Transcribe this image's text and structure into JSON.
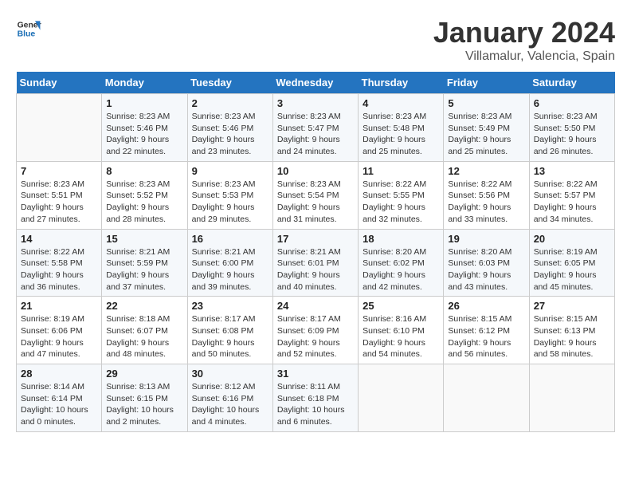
{
  "logo": {
    "line1": "General",
    "line2": "Blue"
  },
  "title": "January 2024",
  "subtitle": "Villamalur, Valencia, Spain",
  "headers": [
    "Sunday",
    "Monday",
    "Tuesday",
    "Wednesday",
    "Thursday",
    "Friday",
    "Saturday"
  ],
  "weeks": [
    [
      {
        "day": "",
        "info": ""
      },
      {
        "day": "1",
        "info": "Sunrise: 8:23 AM\nSunset: 5:46 PM\nDaylight: 9 hours\nand 22 minutes."
      },
      {
        "day": "2",
        "info": "Sunrise: 8:23 AM\nSunset: 5:46 PM\nDaylight: 9 hours\nand 23 minutes."
      },
      {
        "day": "3",
        "info": "Sunrise: 8:23 AM\nSunset: 5:47 PM\nDaylight: 9 hours\nand 24 minutes."
      },
      {
        "day": "4",
        "info": "Sunrise: 8:23 AM\nSunset: 5:48 PM\nDaylight: 9 hours\nand 25 minutes."
      },
      {
        "day": "5",
        "info": "Sunrise: 8:23 AM\nSunset: 5:49 PM\nDaylight: 9 hours\nand 25 minutes."
      },
      {
        "day": "6",
        "info": "Sunrise: 8:23 AM\nSunset: 5:50 PM\nDaylight: 9 hours\nand 26 minutes."
      }
    ],
    [
      {
        "day": "7",
        "info": "Sunrise: 8:23 AM\nSunset: 5:51 PM\nDaylight: 9 hours\nand 27 minutes."
      },
      {
        "day": "8",
        "info": "Sunrise: 8:23 AM\nSunset: 5:52 PM\nDaylight: 9 hours\nand 28 minutes."
      },
      {
        "day": "9",
        "info": "Sunrise: 8:23 AM\nSunset: 5:53 PM\nDaylight: 9 hours\nand 29 minutes."
      },
      {
        "day": "10",
        "info": "Sunrise: 8:23 AM\nSunset: 5:54 PM\nDaylight: 9 hours\nand 31 minutes."
      },
      {
        "day": "11",
        "info": "Sunrise: 8:22 AM\nSunset: 5:55 PM\nDaylight: 9 hours\nand 32 minutes."
      },
      {
        "day": "12",
        "info": "Sunrise: 8:22 AM\nSunset: 5:56 PM\nDaylight: 9 hours\nand 33 minutes."
      },
      {
        "day": "13",
        "info": "Sunrise: 8:22 AM\nSunset: 5:57 PM\nDaylight: 9 hours\nand 34 minutes."
      }
    ],
    [
      {
        "day": "14",
        "info": "Sunrise: 8:22 AM\nSunset: 5:58 PM\nDaylight: 9 hours\nand 36 minutes."
      },
      {
        "day": "15",
        "info": "Sunrise: 8:21 AM\nSunset: 5:59 PM\nDaylight: 9 hours\nand 37 minutes."
      },
      {
        "day": "16",
        "info": "Sunrise: 8:21 AM\nSunset: 6:00 PM\nDaylight: 9 hours\nand 39 minutes."
      },
      {
        "day": "17",
        "info": "Sunrise: 8:21 AM\nSunset: 6:01 PM\nDaylight: 9 hours\nand 40 minutes."
      },
      {
        "day": "18",
        "info": "Sunrise: 8:20 AM\nSunset: 6:02 PM\nDaylight: 9 hours\nand 42 minutes."
      },
      {
        "day": "19",
        "info": "Sunrise: 8:20 AM\nSunset: 6:03 PM\nDaylight: 9 hours\nand 43 minutes."
      },
      {
        "day": "20",
        "info": "Sunrise: 8:19 AM\nSunset: 6:05 PM\nDaylight: 9 hours\nand 45 minutes."
      }
    ],
    [
      {
        "day": "21",
        "info": "Sunrise: 8:19 AM\nSunset: 6:06 PM\nDaylight: 9 hours\nand 47 minutes."
      },
      {
        "day": "22",
        "info": "Sunrise: 8:18 AM\nSunset: 6:07 PM\nDaylight: 9 hours\nand 48 minutes."
      },
      {
        "day": "23",
        "info": "Sunrise: 8:17 AM\nSunset: 6:08 PM\nDaylight: 9 hours\nand 50 minutes."
      },
      {
        "day": "24",
        "info": "Sunrise: 8:17 AM\nSunset: 6:09 PM\nDaylight: 9 hours\nand 52 minutes."
      },
      {
        "day": "25",
        "info": "Sunrise: 8:16 AM\nSunset: 6:10 PM\nDaylight: 9 hours\nand 54 minutes."
      },
      {
        "day": "26",
        "info": "Sunrise: 8:15 AM\nSunset: 6:12 PM\nDaylight: 9 hours\nand 56 minutes."
      },
      {
        "day": "27",
        "info": "Sunrise: 8:15 AM\nSunset: 6:13 PM\nDaylight: 9 hours\nand 58 minutes."
      }
    ],
    [
      {
        "day": "28",
        "info": "Sunrise: 8:14 AM\nSunset: 6:14 PM\nDaylight: 10 hours\nand 0 minutes."
      },
      {
        "day": "29",
        "info": "Sunrise: 8:13 AM\nSunset: 6:15 PM\nDaylight: 10 hours\nand 2 minutes."
      },
      {
        "day": "30",
        "info": "Sunrise: 8:12 AM\nSunset: 6:16 PM\nDaylight: 10 hours\nand 4 minutes."
      },
      {
        "day": "31",
        "info": "Sunrise: 8:11 AM\nSunset: 6:18 PM\nDaylight: 10 hours\nand 6 minutes."
      },
      {
        "day": "",
        "info": ""
      },
      {
        "day": "",
        "info": ""
      },
      {
        "day": "",
        "info": ""
      }
    ]
  ]
}
